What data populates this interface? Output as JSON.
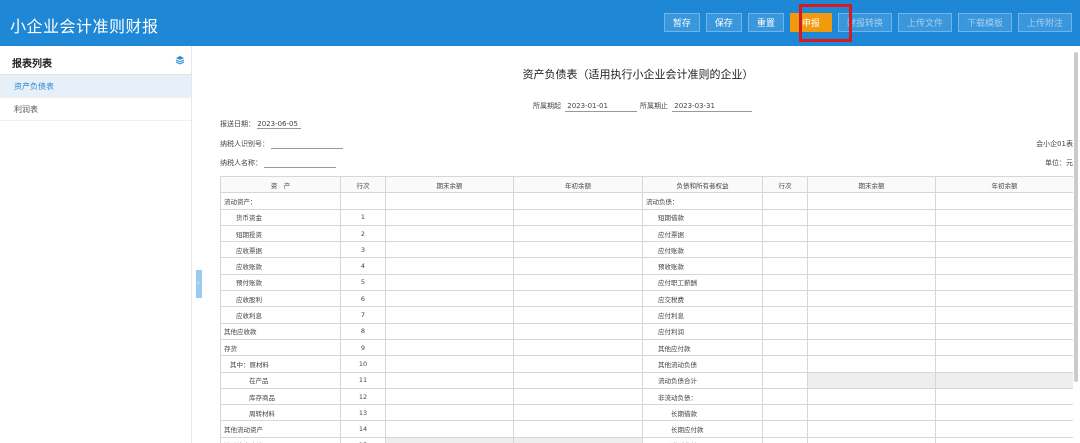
{
  "app": {
    "title": "小企业会计准则财报"
  },
  "toolbar": {
    "buttons": [
      {
        "label": "暂存"
      },
      {
        "label": "保存"
      },
      {
        "label": "重置"
      },
      {
        "label": "申报"
      },
      {
        "label": "财报转换"
      },
      {
        "label": "上传文件"
      },
      {
        "label": "下载模板"
      },
      {
        "label": "上传附注"
      }
    ]
  },
  "sidebar": {
    "title": "报表列表",
    "items": [
      {
        "label": "资产负债表"
      },
      {
        "label": "利润表"
      }
    ]
  },
  "report": {
    "title": "资产负债表（适用执行小企业会计准则的企业）",
    "period_start_label": "所属期起",
    "period_start": "2023-01-01",
    "period_end_label": "所属期止",
    "period_end": "2023-03-31",
    "report_date_label": "报送日期：",
    "report_date": "2023-06-05",
    "taxpayer_id_label": "纳税人识别号：",
    "taxpayer_name_label": "纳税人名称：",
    "form_code": "会小企01表",
    "unit": "单位：元"
  },
  "table": {
    "headers": [
      "资　产",
      "行次",
      "期末余额",
      "年初余额",
      "负债和所有者权益",
      "行次",
      "期末余额",
      "年初余额"
    ],
    "rows": [
      {
        "a": "流动资产：",
        "al": "",
        "b": "流动负债：",
        "bl": ""
      },
      {
        "a": "货币资金",
        "al": "1",
        "b": "短期借款",
        "bl": ""
      },
      {
        "a": "短期投资",
        "al": "2",
        "b": "应付票据",
        "bl": ""
      },
      {
        "a": "应收票据",
        "al": "3",
        "b": "应付账款",
        "bl": ""
      },
      {
        "a": "应收账款",
        "al": "4",
        "b": "预收账款",
        "bl": ""
      },
      {
        "a": "预付账款",
        "al": "5",
        "b": "应付职工薪酬",
        "bl": ""
      },
      {
        "a": "应收股利",
        "al": "6",
        "b": "应交税费",
        "bl": ""
      },
      {
        "a": "应收利息",
        "al": "7",
        "b": "应付利息",
        "bl": ""
      },
      {
        "a": "其他应收款",
        "al": "8",
        "b": "应付利润",
        "bl": ""
      },
      {
        "a": "存货",
        "al": "9",
        "b": "其他应付款",
        "bl": ""
      },
      {
        "a": "其中：原材料",
        "al": "10",
        "b": "其他流动负债",
        "bl": ""
      },
      {
        "a": "在产品",
        "al": "11",
        "b": "流动负债合计",
        "bl": ""
      },
      {
        "a": "库存商品",
        "al": "12",
        "b": "非流动负债：",
        "bl": ""
      },
      {
        "a": "周转材料",
        "al": "13",
        "b": "长期借款",
        "bl": ""
      },
      {
        "a": "其他流动资产",
        "al": "14",
        "b": "长期应付款",
        "bl": ""
      },
      {
        "a": "流动资产合计",
        "al": "15",
        "b": "递延收益",
        "bl": ""
      }
    ]
  },
  "colors": {
    "header_bg": "#1e88d6",
    "active_button": "#f19a0e",
    "highlight": "#d71920"
  }
}
